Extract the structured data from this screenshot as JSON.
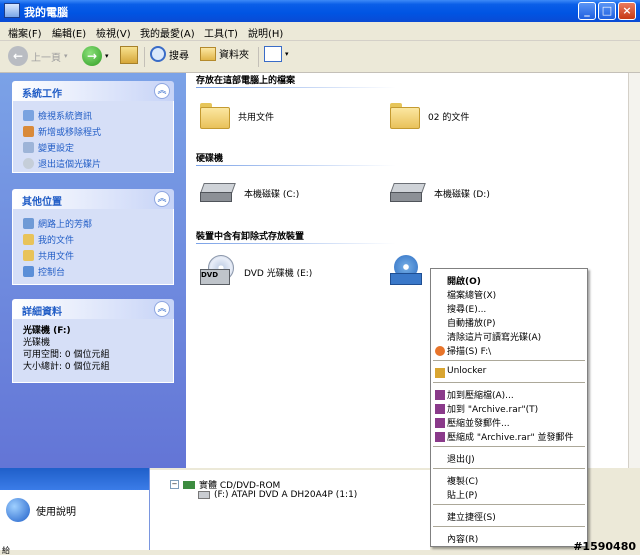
{
  "window": {
    "title": "我的電腦"
  },
  "menubar": {
    "items": [
      "檔案(F)",
      "編輯(E)",
      "檢視(V)",
      "我的最愛(A)",
      "工具(T)",
      "說明(H)"
    ]
  },
  "toolbar": {
    "back": "上一頁",
    "search": "搜尋",
    "folders": "資料夾"
  },
  "sidebar": {
    "system_tasks": {
      "title": "系統工作",
      "items": [
        "檢視系統資訊",
        "新增或移除程式",
        "變更設定",
        "退出這個光碟片"
      ]
    },
    "other_places": {
      "title": "其他位置",
      "items": [
        "網路上的芳鄰",
        "我的文件",
        "共用文件",
        "控制台"
      ]
    },
    "details": {
      "title": "詳細資料",
      "name": "光碟機 (F:)",
      "type": "光碟機",
      "free": "可用空間: 0 個位元組",
      "total": "大小總計: 0 個位元組"
    }
  },
  "content": {
    "groups": [
      {
        "title": "存放在這部電腦上的檔案",
        "items": [
          "共用文件",
          "02 的文件"
        ]
      },
      {
        "title": "硬碟機",
        "items": [
          "本機磁碟 (C:)",
          "本機磁碟 (D:)"
        ]
      },
      {
        "title": "裝置中含有卸除式存放裝置",
        "items": [
          "DVD 光碟機 (E:)"
        ]
      }
    ]
  },
  "context_menu": {
    "items": [
      {
        "label": "開啟(O)",
        "bold": true
      },
      {
        "label": "檔案總管(X)"
      },
      {
        "label": "搜尋(E)..."
      },
      {
        "label": "自動播放(P)"
      },
      {
        "label": "清除這片可讀寫光碟(A)"
      },
      {
        "label": "掃描(S) F:\\"
      },
      {
        "label": "Unlocker"
      },
      {
        "label": "加到壓縮檔(A)..."
      },
      {
        "label": "加到 \"Archive.rar\"(T)"
      },
      {
        "label": "壓縮並發郵件..."
      },
      {
        "label": "壓縮成 \"Archive.rar\" 並發郵件"
      },
      {
        "label": "退出(J)"
      },
      {
        "label": "複製(C)"
      },
      {
        "label": "貼上(P)"
      },
      {
        "label": "建立捷徑(S)"
      },
      {
        "label": "內容(R)"
      }
    ]
  },
  "background": {
    "help_label": "使用說明",
    "tree_root": "實體 CD/DVD-ROM",
    "tree_child": "(F:) ATAPI DVD A  DH20A4P (1:1)",
    "status_left": "給",
    "dvd_label": "DVD"
  },
  "watermark": "#1590480",
  "colors": {
    "title_bar": "#0054e3",
    "sidebar": "#7ba2e7",
    "link": "#215dc6"
  }
}
